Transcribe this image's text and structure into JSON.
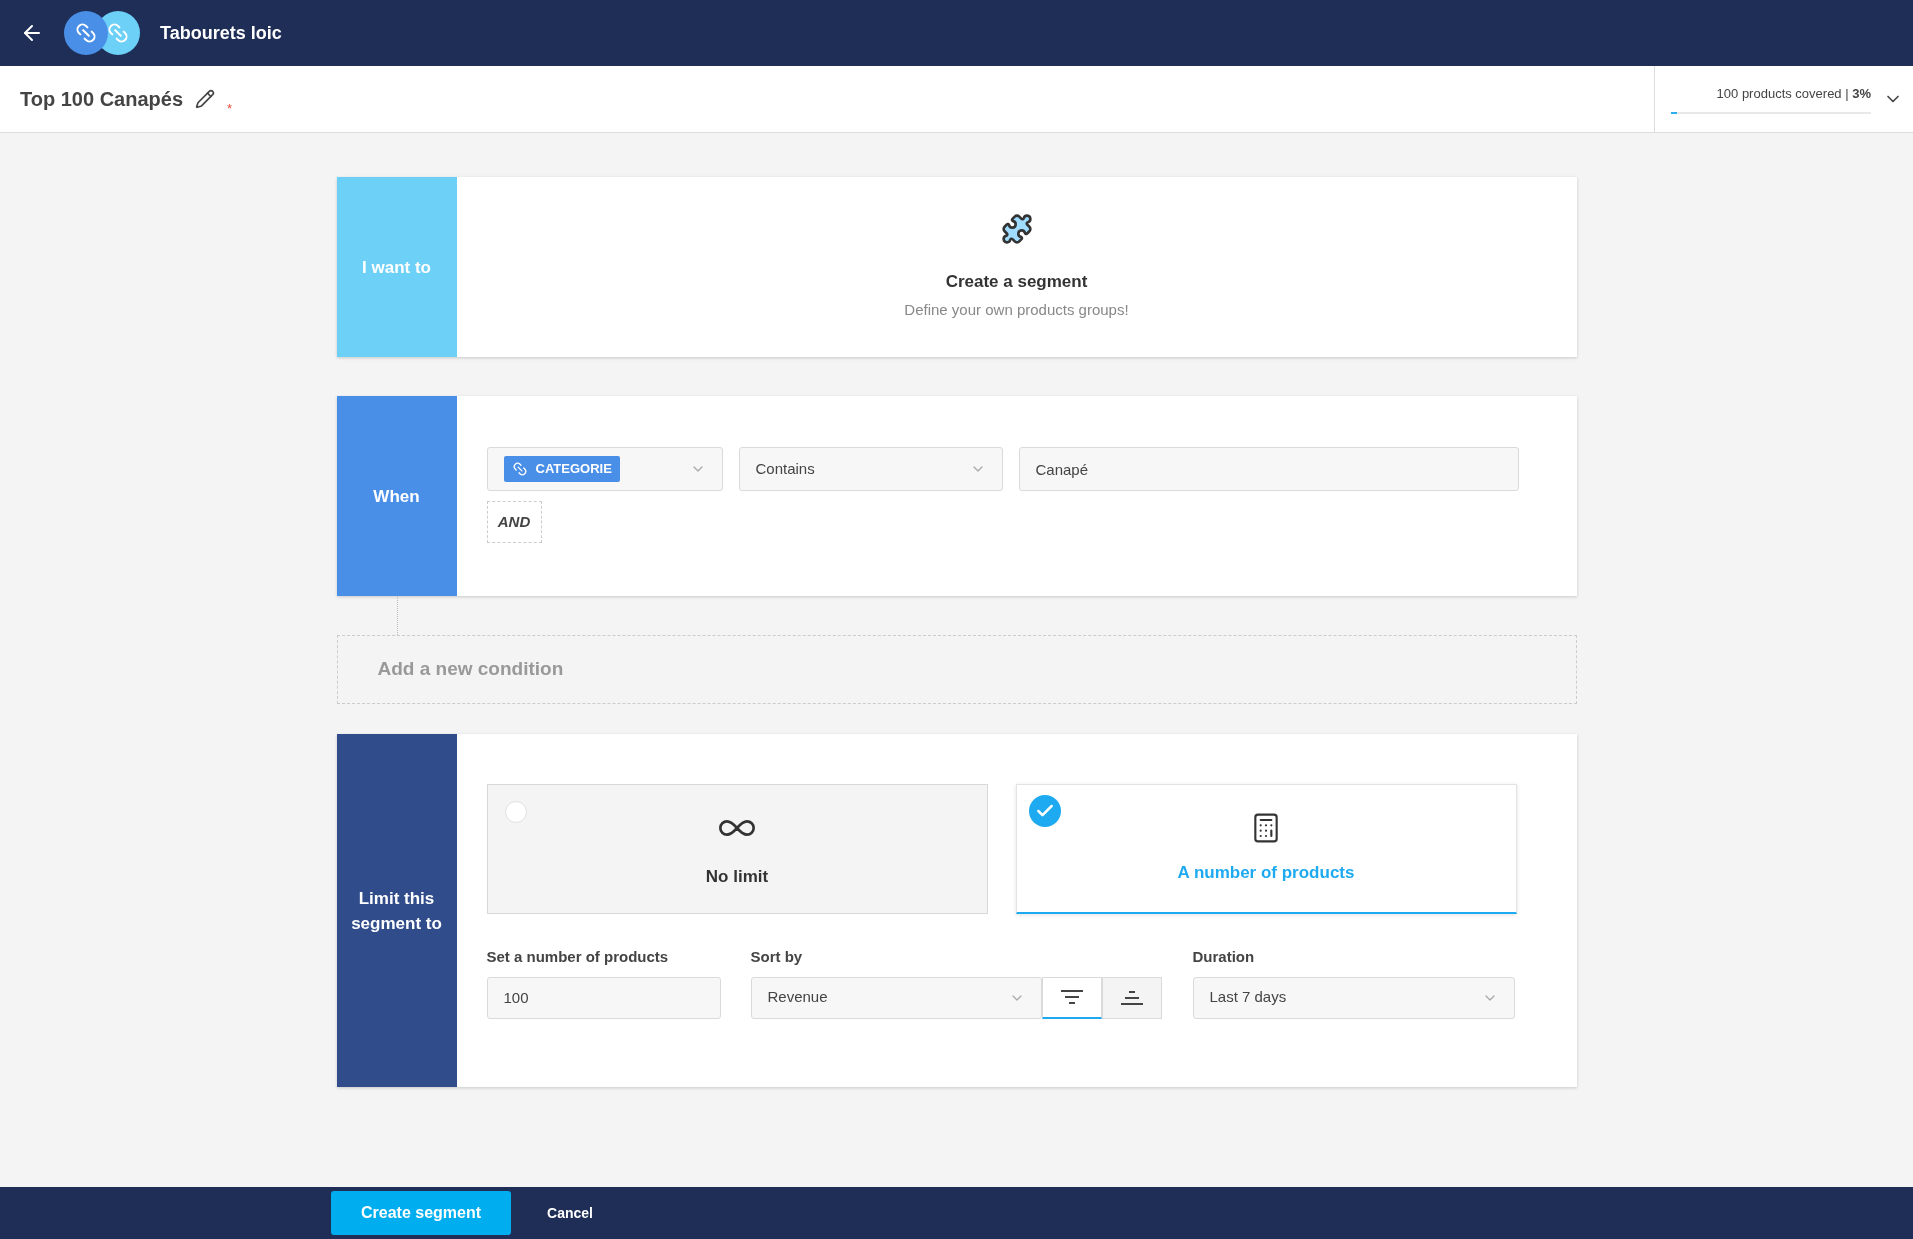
{
  "header": {
    "title": "Tabourets loic"
  },
  "segment": {
    "name": "Top 100 Canapés",
    "required_mark": "*"
  },
  "coverage": {
    "text": "100 products covered | **3%**",
    "level": 0.03
  },
  "intent": {
    "label": "I want to",
    "title": "Create a segment",
    "subtitle": "Define your own products groups!"
  },
  "condition": {
    "label": "When",
    "attribute": "CATEGORIE",
    "operator": "Contains",
    "value": "Canapé",
    "connector": "AND"
  },
  "add_condition": {
    "label": "Add a new condition"
  },
  "limit": {
    "label": "Limit this segment to",
    "options": [
      {
        "kind": "unlimited",
        "label": "No limit",
        "selected": false
      },
      {
        "kind": "count",
        "label": "A number of products",
        "selected": true
      }
    ],
    "count_label": "Set a number of products",
    "count_value": "100",
    "sort_label": "Sort by",
    "sort_value": "Revenue",
    "sort_directions": [
      {
        "kind": "descending",
        "selected": true
      },
      {
        "kind": "ascending",
        "selected": false
      }
    ],
    "duration_label": "Duration",
    "duration_value": "Last 7 days"
  },
  "footer": {
    "buttons": [
      "Create segment",
      "Cancel"
    ]
  }
}
